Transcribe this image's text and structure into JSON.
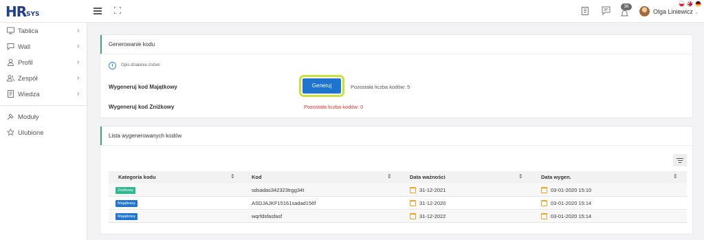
{
  "header": {
    "logo_main": "HR",
    "logo_sub": "SYS",
    "notifications_count": "36",
    "user_name": "Olga Liniewicz",
    "user_caret": "⌄"
  },
  "sidebar": {
    "items": [
      {
        "label": "Tablica",
        "icon": "monitor-icon"
      },
      {
        "label": "Wall",
        "icon": "chat-icon"
      },
      {
        "label": "Profil",
        "icon": "user-icon"
      },
      {
        "label": "Zespół",
        "icon": "team-icon"
      },
      {
        "label": "Wiedza",
        "icon": "book-icon"
      },
      {
        "label": "Moduły",
        "icon": "puzzle-icon"
      },
      {
        "label": "Ulubione",
        "icon": "star-icon"
      }
    ],
    "chevron": "›"
  },
  "generate": {
    "title": "Generowanie kodu",
    "info": "Opis działania zniżek:",
    "info_icon": "i",
    "row1_label": "Wygeneruj kod Majątkowy",
    "button_label": "Generuj",
    "row1_remaining": "Pozostała liczba kodów: 5",
    "row2_label": "Wygeneruj kod Zniżkowy",
    "row2_remaining": "Pozostała liczba kodów: 0"
  },
  "list": {
    "title": "Lista wygenerowanych kodów",
    "columns": [
      "Kategoria kodu",
      "Kod",
      "Data ważności",
      "Data wygen."
    ],
    "sort_glyph": "⇕",
    "rows": [
      {
        "category": "Zniżkowy",
        "category_color": "#2fb78e",
        "code": "sdsadas342323trgg34t",
        "expiry": "31-12-2021",
        "generated": "03-01-2020 15:10"
      },
      {
        "category": "Majątkowy",
        "category_color": "#1e74cf",
        "code": "ASDJAJKF15161sadad156f",
        "expiry": "31-12-2020",
        "generated": "03-01-2020 15:14"
      },
      {
        "category": "Majątkowy",
        "category_color": "#1e74cf",
        "code": "wqrfdsfasfasf",
        "expiry": "31-12-2022",
        "generated": "03-01-2020 15:14"
      }
    ]
  },
  "colors": {
    "accent_green": "#3aa67a",
    "primary_blue": "#1e74cf",
    "highlight_lime": "#c4e43a",
    "error_red": "#e8322b"
  }
}
